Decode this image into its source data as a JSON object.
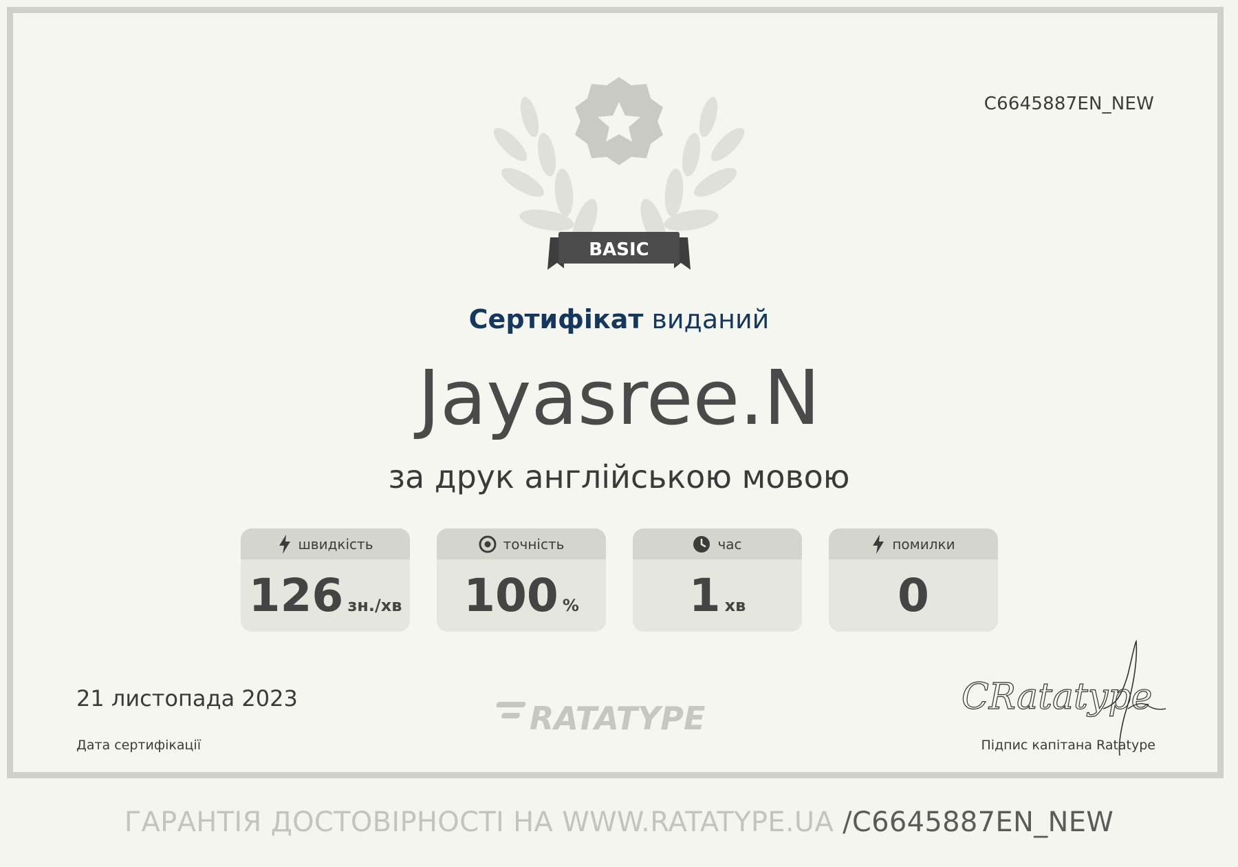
{
  "certificate": {
    "id": "C6645887EN_NEW",
    "level": "BASIC",
    "issued_bold": "Сертифікат",
    "issued_rest": "виданий",
    "name": "Jayasree.N",
    "subtitle": "за друк англійською мовою"
  },
  "stats": [
    {
      "label": "швидкість",
      "value": "126",
      "unit": "зн./хв",
      "icon": "lightning-icon"
    },
    {
      "label": "точність",
      "value": "100",
      "unit": "%",
      "icon": "target-icon"
    },
    {
      "label": "час",
      "value": "1",
      "unit": "хв",
      "icon": "clock-icon"
    },
    {
      "label": "помилки",
      "value": "0",
      "unit": "",
      "icon": "lightning-icon"
    }
  ],
  "date": {
    "value": "21 листопада 2023",
    "label": "Дата сертифікації"
  },
  "logo": {
    "text": "RATATYPE"
  },
  "signature": {
    "label": "Підпис капітана Ratatype",
    "handwriting": "CRatatype"
  },
  "footer": {
    "prefix": "ГАРАНТІЯ ДОСТОВІРНОСТІ НА WWW.RATATYPE.UA",
    "suffix": "/C6645887EN_NEW"
  },
  "colors": {
    "background": "#f5f6ef",
    "frame": "#cfd0c9",
    "issued_text": "#15375e",
    "card": "#e5e6de",
    "card_header": "#d4d5cd"
  }
}
